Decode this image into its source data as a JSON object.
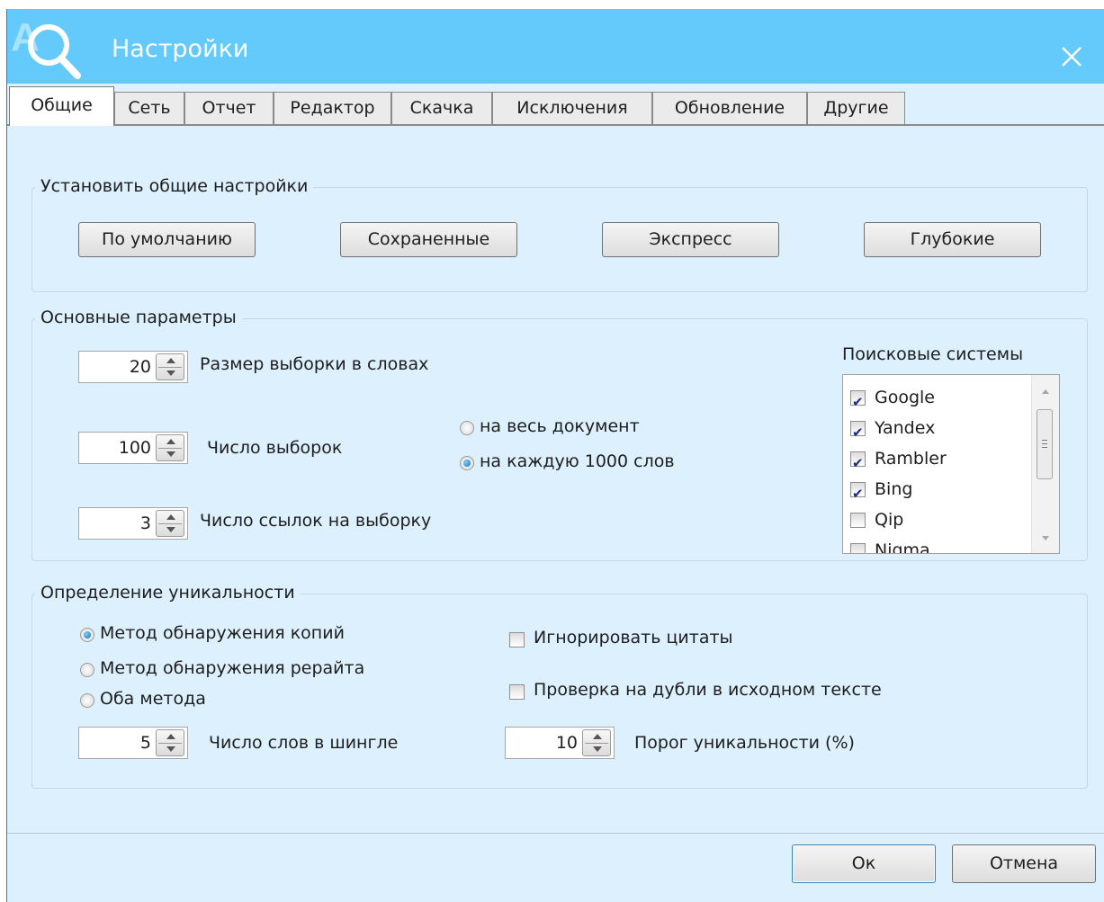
{
  "window": {
    "title": "Настройки",
    "colors": {
      "titlebar": "#64c9fb",
      "body": "#dcf0fd"
    }
  },
  "tabs": [
    {
      "label": "Общие",
      "active": true
    },
    {
      "label": "Сеть",
      "active": false
    },
    {
      "label": "Отчет",
      "active": false
    },
    {
      "label": "Редактор",
      "active": false
    },
    {
      "label": "Скачка",
      "active": false
    },
    {
      "label": "Исключения",
      "active": false
    },
    {
      "label": "Обновление",
      "active": false
    },
    {
      "label": "Другие",
      "active": false
    }
  ],
  "general_settings": {
    "legend": "Установить общие настройки",
    "buttons": {
      "default": "По умолчанию",
      "saved": "Сохраненные",
      "express": "Экспресс",
      "deep": "Глубокие"
    }
  },
  "main_params": {
    "legend": "Основные параметры",
    "sample_size": {
      "value": "20",
      "label": "Размер выборки в словах"
    },
    "sample_count": {
      "value": "100",
      "label": "Число выборок"
    },
    "links_per_sample": {
      "value": "3",
      "label": "Число ссылок на выборку"
    },
    "scope": {
      "whole_document": {
        "label": "на весь документ",
        "selected": false
      },
      "per_1000_words": {
        "label": "на каждую 1000 слов",
        "selected": true
      }
    },
    "search_engines": {
      "label": "Поисковые системы",
      "items": [
        {
          "label": "Google",
          "checked": true
        },
        {
          "label": "Yandex",
          "checked": true
        },
        {
          "label": "Rambler",
          "checked": true
        },
        {
          "label": "Bing",
          "checked": true
        },
        {
          "label": "Qip",
          "checked": false
        },
        {
          "label": "Nigma",
          "checked": false
        }
      ]
    }
  },
  "uniqueness": {
    "legend": "Определение уникальности",
    "methods": [
      {
        "label": "Метод обнаружения копий",
        "selected": true
      },
      {
        "label": "Метод обнаружения рерайта",
        "selected": false
      },
      {
        "label": "Оба метода",
        "selected": false
      }
    ],
    "ignore_quotes": {
      "label": "Игнорировать цитаты",
      "checked": false
    },
    "check_duplicates": {
      "label": "Проверка на дубли в исходном тексте",
      "checked": false
    },
    "shingle_words": {
      "value": "5",
      "label": "Число слов в шингле"
    },
    "threshold": {
      "value": "10",
      "label": "Порог уникальности (%)"
    }
  },
  "footer": {
    "ok": "Ок",
    "cancel": "Отмена"
  }
}
